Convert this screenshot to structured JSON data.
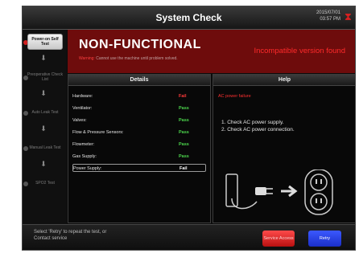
{
  "header": {
    "title": "System Check",
    "date": "2015/07/01",
    "time": "03:57 PM"
  },
  "sidebar": {
    "steps": [
      {
        "label": "Power-on Self Test",
        "status_color": "#d02020"
      },
      {
        "label": "Preoperative Check List",
        "status_color": "#555555"
      },
      {
        "label": "Auto Leak Test",
        "status_color": "#555555"
      },
      {
        "label": "Manual Leak Test",
        "status_color": "#555555"
      },
      {
        "label": "SPO2 Test",
        "status_color": "#555555"
      }
    ]
  },
  "banner": {
    "status": "NON-FUNCTIONAL",
    "warning_prefix": "Warning:",
    "warning_text": "Cannot use the machine until problem solved.",
    "incompat_message": "Incompatible version found"
  },
  "details": {
    "heading": "Details",
    "rows": [
      {
        "label": "Hardware:",
        "result": "Fail"
      },
      {
        "label": "Ventilator:",
        "result": "Pass"
      },
      {
        "label": "Valves:",
        "result": "Pass"
      },
      {
        "label": "Flow & Pressure Sensors:",
        "result": "Pass"
      },
      {
        "label": "Flowmeter:",
        "result": "Pass"
      },
      {
        "label": "Gas Supply:",
        "result": "Pass"
      },
      {
        "label": "Power Supply:",
        "result": "Fail"
      }
    ]
  },
  "help": {
    "heading": "Help",
    "title": "AC power failure",
    "steps": [
      "1. Check AC power supply.",
      "2. Check AC power connection."
    ]
  },
  "footer": {
    "line1": "Select 'Retry' to repeat the test, or",
    "line2": "Contact service",
    "service_button": "Service Access",
    "retry_button": "Retry"
  },
  "colors": {
    "accent_red": "#6e0c0c",
    "pass": "#4cd44c",
    "fail": "#ff3a3a",
    "retry": "#2a42e0"
  }
}
